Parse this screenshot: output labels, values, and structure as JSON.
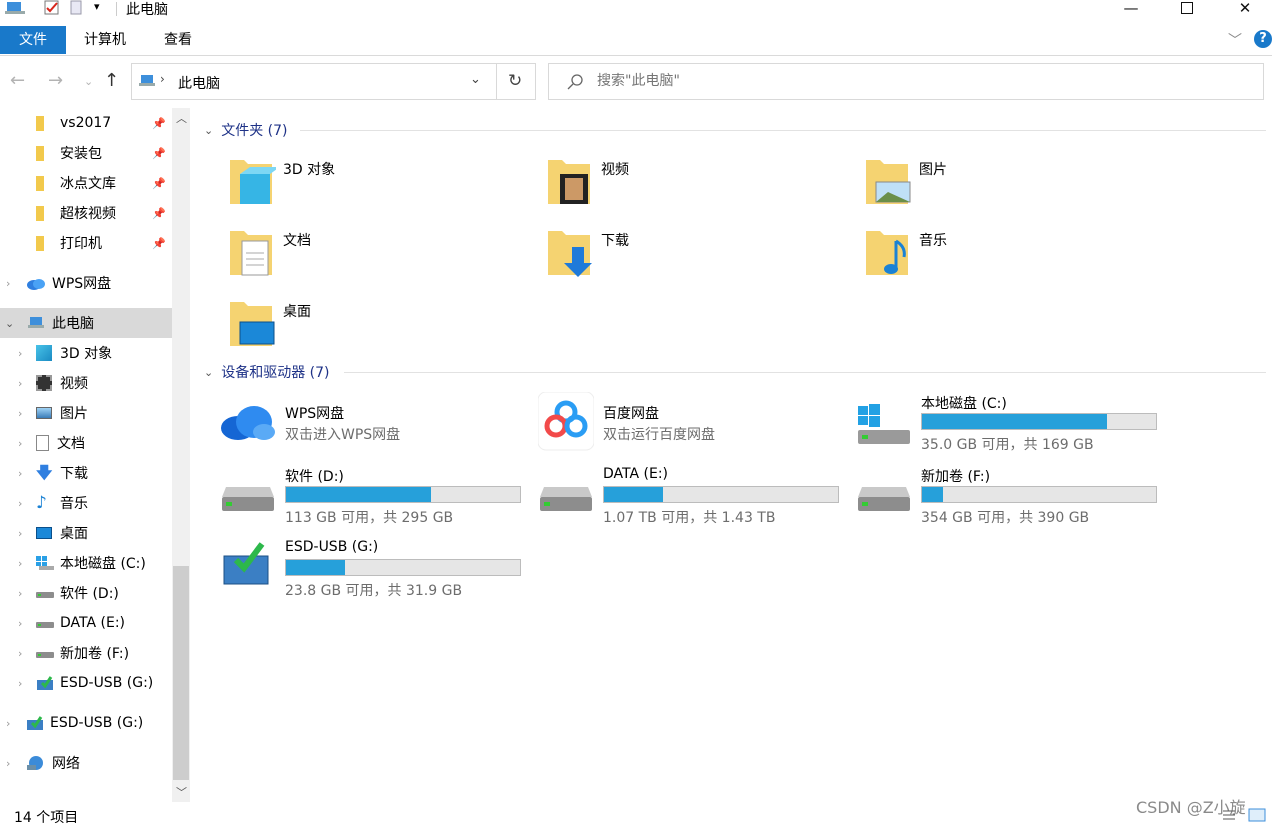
{
  "window": {
    "title": "此电脑"
  },
  "ribbon": {
    "tabs": [
      "文件",
      "计算机",
      "查看"
    ]
  },
  "address": {
    "path": "此电脑"
  },
  "search": {
    "placeholder": "搜索\"此电脑\""
  },
  "nav": {
    "pinned": [
      {
        "label": "vs2017"
      },
      {
        "label": "安装包"
      },
      {
        "label": "冰点文库"
      },
      {
        "label": "超核视频"
      },
      {
        "label": "打印机"
      }
    ],
    "wps": "WPS网盘",
    "thispc": "此电脑",
    "children": [
      "3D 对象",
      "视频",
      "图片",
      "文档",
      "下载",
      "音乐",
      "桌面",
      "本地磁盘 (C:)",
      "软件 (D:)",
      "DATA (E:)",
      "新加卷 (F:)",
      "ESD-USB (G:)"
    ],
    "esd": "ESD-USB (G:)",
    "network": "网络"
  },
  "content": {
    "folders_header": "文件夹 (7)",
    "folders": [
      "3D 对象",
      "视频",
      "图片",
      "文档",
      "下载",
      "音乐",
      "桌面"
    ],
    "devices_header": "设备和驱动器 (7)",
    "cloud": [
      {
        "name": "WPS网盘",
        "sub": "双击进入WPS网盘"
      },
      {
        "name": "百度网盘",
        "sub": "双击运行百度网盘"
      }
    ],
    "drives": [
      {
        "name": "本地磁盘 (C:)",
        "free": "35.0 GB 可用，共 169 GB",
        "used_fraction": 0.79
      },
      {
        "name": "软件 (D:)",
        "free": "113 GB 可用，共 295 GB",
        "used_fraction": 0.62
      },
      {
        "name": "DATA (E:)",
        "free": "1.07 TB 可用，共 1.43 TB",
        "used_fraction": 0.25
      },
      {
        "name": "新加卷 (F:)",
        "free": "354 GB 可用，共 390 GB",
        "used_fraction": 0.09
      },
      {
        "name": "ESD-USB (G:)",
        "free": "23.8 GB 可用，共 31.9 GB",
        "used_fraction": 0.25
      }
    ]
  },
  "status": {
    "count": "14 个项目"
  },
  "watermark": "CSDN @Z小旋",
  "colors": {
    "accent": "#1979ca",
    "bar": "#26a0da",
    "group_header": "#1e3287"
  }
}
